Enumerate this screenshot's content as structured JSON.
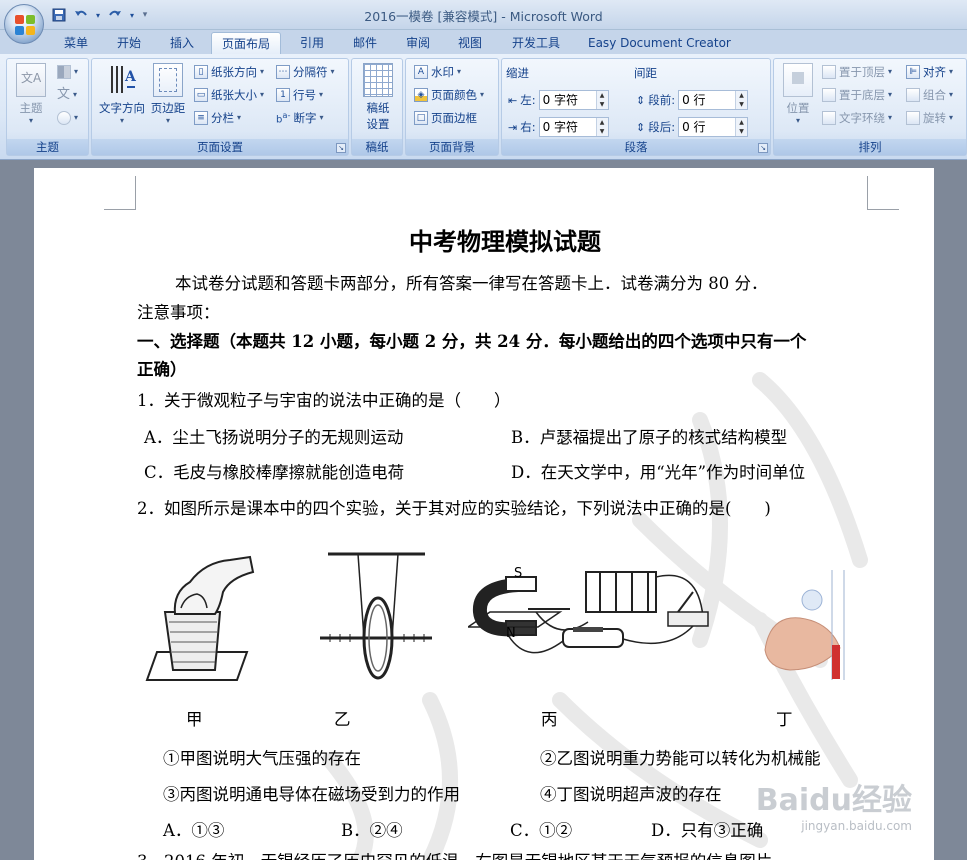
{
  "window": {
    "title": "2016一模卷 [兼容模式] - Microsoft Word"
  },
  "quick_access": {
    "save_icon": "save-icon",
    "undo_icon": "undo-icon",
    "redo_icon": "redo-icon",
    "customize_icon": "dropdown-icon"
  },
  "tabs": [
    "菜单",
    "开始",
    "插入",
    "页面布局",
    "引用",
    "邮件",
    "审阅",
    "视图",
    "开发工具",
    "Easy Document Creator"
  ],
  "active_tab": "页面布局",
  "ribbon": {
    "theme_group": {
      "label": "主题",
      "theme_btn": "主题",
      "colors_icon": "theme-colors-icon",
      "fonts_label": "文",
      "effects_icon": "theme-effects-icon"
    },
    "page_setup": {
      "label": "页面设置",
      "text_direction": "文字方向",
      "margins": "页边距",
      "orientation": "纸张方向",
      "size": "纸张大小",
      "columns": "分栏",
      "breaks": "分隔符",
      "line_numbers": "行号",
      "hyphenation": "断字"
    },
    "manuscript": {
      "label": "稿纸",
      "settings_line1": "稿纸",
      "settings_line2": "设置"
    },
    "page_background": {
      "label": "页面背景",
      "watermark": "水印",
      "page_color": "页面颜色",
      "page_borders": "页面边框"
    },
    "paragraph": {
      "label": "段落",
      "indent_title": "缩进",
      "spacing_title": "间距",
      "left_label": "左:",
      "left_value": "0 字符",
      "right_label": "右:",
      "right_value": "0 字符",
      "before_label": "段前:",
      "before_value": "0 行",
      "after_label": "段后:",
      "after_value": "0 行"
    },
    "arrange": {
      "label": "排列",
      "position": "位置",
      "bring_front": "置于顶层",
      "send_back": "置于底层",
      "text_wrap": "文字环绕",
      "align": "对齐",
      "group": "组合",
      "rotate": "旋转"
    }
  },
  "document": {
    "title": "中考物理模拟试题",
    "intro": "本试卷分试题和答题卡两部分，所有答案一律写在答题卡上．试卷满分为 80 分．",
    "notice": "注意事项：",
    "section1_line1": "一、选择题（本题共 12 小题，每小题 2 分，共 24 分．每小题给出的四个选项中只有一个",
    "section1_line2": "正确）",
    "q1": "1．关于微观粒子与宇宙的说法中正确的是（　　）",
    "q1_a": "A．尘土飞扬说明分子的无规则运动",
    "q1_b": "B．卢瑟福提出了原子的核式结构模型",
    "q1_c": "C．毛皮与橡胶棒摩擦就能创造电荷",
    "q1_d": "D．在天文学中，用“光年”作为时间单位",
    "q2": "2．如图所示是课本中的四个实验，关于其对应的实验结论，下列说法中正确的是(　　)",
    "fig_labels": [
      "甲",
      "乙",
      "丙",
      "丁"
    ],
    "magnet_s": "S",
    "magnet_n": "N",
    "stmt1": "①甲图说明大气压强的存在",
    "stmt2": "②乙图说明重力势能可以转化为机械能",
    "stmt3": "③丙图说明通电导体在磁场受到力的作用",
    "stmt4": "④丁图说明超声波的存在",
    "q2_a": "A．①③",
    "q2_b": "B．②④",
    "q2_c": "C．①②",
    "q2_d": "D．只有③正确",
    "q3_partial": "3．2016 年初，无锡经历了历史罕见的低温．右图是无锡地区某天天气预报的信息图片"
  },
  "watermark": {
    "brand": "Baidu经验",
    "url": "jingyan.baidu.com"
  },
  "colors": {
    "ribbon_text": "#15428b",
    "tab_bg": "#c5d5ea",
    "doc_bg": "#7e8898"
  }
}
